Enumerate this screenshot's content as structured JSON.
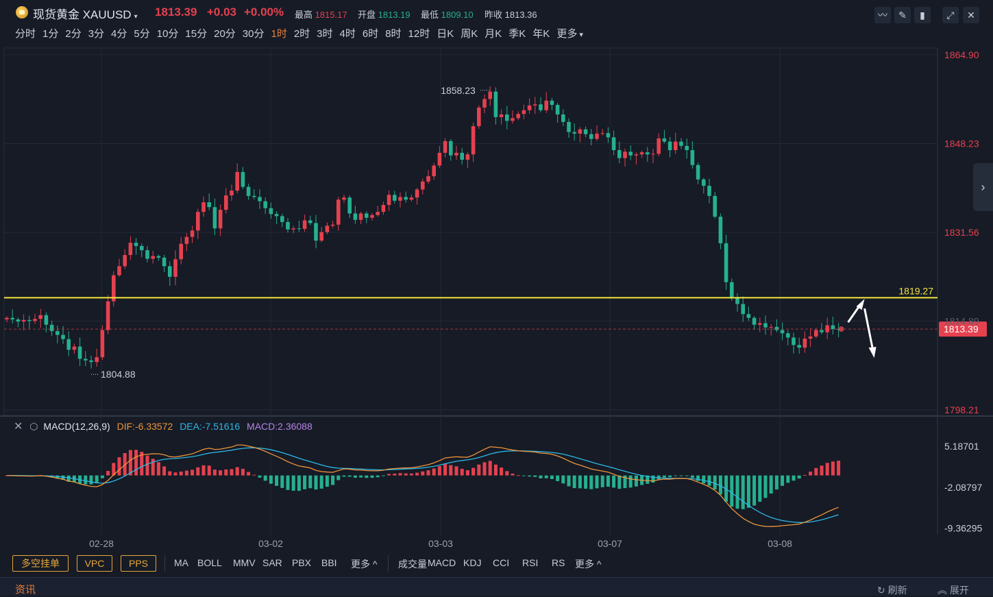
{
  "header": {
    "title": "现货黄金 XAUUSD",
    "price": "1813.39",
    "change": "+0.03",
    "change_pct": "+0.00%",
    "high_label": "最高",
    "high": "1815.17",
    "open_label": "开盘",
    "open": "1813.19",
    "low_label": "最低",
    "low": "1809.10",
    "prev_label": "昨收",
    "prev": "1813.36"
  },
  "toolbar": {
    "icons": [
      "line-icon",
      "pen-icon",
      "candle-icon",
      "expand-icon",
      "close-icon"
    ]
  },
  "periods": [
    "分时",
    "1分",
    "2分",
    "3分",
    "4分",
    "5分",
    "10分",
    "15分",
    "20分",
    "30分",
    "1时",
    "2时",
    "3时",
    "4时",
    "6时",
    "8时",
    "12时",
    "日K",
    "周K",
    "月K",
    "季K",
    "年K",
    "更多"
  ],
  "active_period": "1时",
  "indicator_header": {
    "name": "MACD(12,26,9)",
    "dif": "DIF:-6.33572",
    "dea": "DEA:-7.51616",
    "macd": "MACD:2.36088"
  },
  "bottom": {
    "order_buttons": [
      "多空挂单",
      "VPC",
      "PPS"
    ],
    "main_indicators": [
      "MA",
      "BOLL",
      "MMV",
      "SAR",
      "PBX",
      "BBI",
      "更多 ^"
    ],
    "sub_indicators": [
      "成交量",
      "MACD",
      "KDJ",
      "CCI",
      "RSI",
      "RS",
      "更多 ^"
    ]
  },
  "news": {
    "label": "资讯",
    "refresh": "刷新",
    "expand": "展开"
  },
  "colors": {
    "up": "#e5414f",
    "down": "#26b08f",
    "level": "#f5e63c",
    "dif": "#f0943a",
    "dea": "#2eb8e6",
    "bg": "#161b26"
  },
  "chart_data": [
    {
      "type": "candlestick",
      "title": "",
      "x_ticks": [
        "02-28",
        "03-02",
        "03-03",
        "03-07",
        "03-08"
      ],
      "y_ticks": [
        "1864.90",
        "1848.23",
        "1831.56",
        "1814.89",
        "1798.21"
      ],
      "ylim": [
        1798.21,
        1864.9
      ],
      "grid": true,
      "annotations": {
        "high": "1858.23",
        "low": "1804.88",
        "level": "1819.27",
        "last": "1813.39"
      },
      "level_value": 1819.27,
      "last_value": 1813.39,
      "high_value": 1858.23,
      "low_value": 1804.88,
      "closes": [
        1815.5,
        1815.2,
        1814.8,
        1815.1,
        1814.9,
        1815.3,
        1816.0,
        1814.2,
        1813.0,
        1812.3,
        1811.5,
        1809.5,
        1810.1,
        1807.8,
        1807.5,
        1807.2,
        1808.1,
        1813.2,
        1818.6,
        1823.5,
        1825.2,
        1827.3,
        1829.6,
        1829.0,
        1828.2,
        1826.6,
        1827.1,
        1826.8,
        1825.2,
        1823.2,
        1826.5,
        1829.4,
        1830.7,
        1831.9,
        1835.4,
        1837.2,
        1836.3,
        1832.3,
        1835.8,
        1838.5,
        1839.4,
        1842.9,
        1840.1,
        1838.4,
        1838.2,
        1837.4,
        1836.1,
        1835.0,
        1834.6,
        1833.5,
        1832.1,
        1832.3,
        1832.2,
        1833.8,
        1833.3,
        1830.0,
        1831.6,
        1832.8,
        1833.0,
        1837.7,
        1838.1,
        1835.1,
        1833.9,
        1835.1,
        1834.3,
        1834.8,
        1835.4,
        1836.7,
        1838.6,
        1837.5,
        1838.2,
        1837.7,
        1838.1,
        1839.6,
        1841.1,
        1842.1,
        1844.1,
        1846.5,
        1848.7,
        1846.0,
        1846.5,
        1845.2,
        1846.2,
        1851.5,
        1855.0,
        1856.6,
        1858.0,
        1853.2,
        1853.7,
        1852.5,
        1853.0,
        1853.8,
        1854.5,
        1855.4,
        1855.6,
        1854.5,
        1856.3,
        1855.5,
        1853.7,
        1852.3,
        1850.4,
        1850.1,
        1850.9,
        1850.0,
        1849.1,
        1850.1,
        1850.2,
        1849.4,
        1847.0,
        1845.5,
        1846.7,
        1846.0,
        1846.2,
        1846.6,
        1846.2,
        1846.3,
        1849.2,
        1848.6,
        1847.0,
        1848.6,
        1847.8,
        1847.0,
        1844.2,
        1841.5,
        1840.3,
        1838.4,
        1834.5,
        1829.5,
        1822.2,
        1819.2,
        1818.1,
        1816.2,
        1815.5,
        1814.2,
        1814.5,
        1813.7,
        1813.8,
        1813.2,
        1812.6,
        1811.8,
        1810.4,
        1809.9,
        1811.6,
        1812.0,
        1813.2,
        1812.8,
        1814.1,
        1813.4,
        1813.39
      ],
      "sub_chart": {
        "type": "bar+line",
        "name": "MACD(12,26,9)",
        "y_ticks": [
          "5.18701",
          "-2.08797",
          "-9.36295"
        ],
        "ylim": [
          -10.5,
          7.5
        ],
        "dif_last": -6.33572,
        "dea_last": -7.51616,
        "macd_last": 2.36088
      }
    }
  ]
}
